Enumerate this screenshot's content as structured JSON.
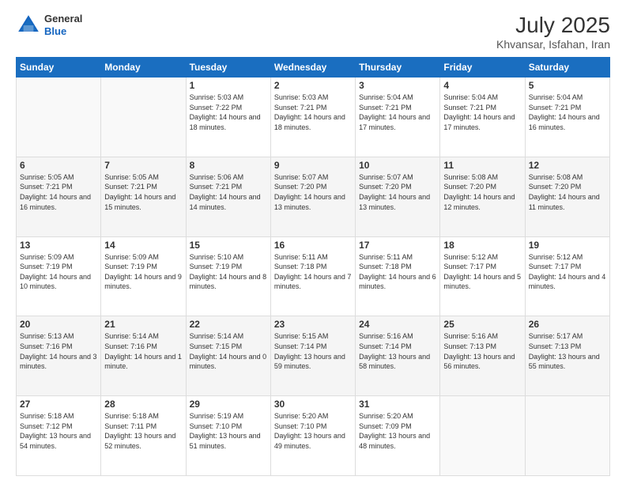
{
  "header": {
    "logo_general": "General",
    "logo_blue": "Blue",
    "title": "July 2025",
    "subtitle": "Khvansar, Isfahan, Iran"
  },
  "days_of_week": [
    "Sunday",
    "Monday",
    "Tuesday",
    "Wednesday",
    "Thursday",
    "Friday",
    "Saturday"
  ],
  "weeks": [
    [
      {
        "num": "",
        "info": ""
      },
      {
        "num": "",
        "info": ""
      },
      {
        "num": "1",
        "info": "Sunrise: 5:03 AM\nSunset: 7:22 PM\nDaylight: 14 hours and 18 minutes."
      },
      {
        "num": "2",
        "info": "Sunrise: 5:03 AM\nSunset: 7:21 PM\nDaylight: 14 hours and 18 minutes."
      },
      {
        "num": "3",
        "info": "Sunrise: 5:04 AM\nSunset: 7:21 PM\nDaylight: 14 hours and 17 minutes."
      },
      {
        "num": "4",
        "info": "Sunrise: 5:04 AM\nSunset: 7:21 PM\nDaylight: 14 hours and 17 minutes."
      },
      {
        "num": "5",
        "info": "Sunrise: 5:04 AM\nSunset: 7:21 PM\nDaylight: 14 hours and 16 minutes."
      }
    ],
    [
      {
        "num": "6",
        "info": "Sunrise: 5:05 AM\nSunset: 7:21 PM\nDaylight: 14 hours and 16 minutes."
      },
      {
        "num": "7",
        "info": "Sunrise: 5:05 AM\nSunset: 7:21 PM\nDaylight: 14 hours and 15 minutes."
      },
      {
        "num": "8",
        "info": "Sunrise: 5:06 AM\nSunset: 7:21 PM\nDaylight: 14 hours and 14 minutes."
      },
      {
        "num": "9",
        "info": "Sunrise: 5:07 AM\nSunset: 7:20 PM\nDaylight: 14 hours and 13 minutes."
      },
      {
        "num": "10",
        "info": "Sunrise: 5:07 AM\nSunset: 7:20 PM\nDaylight: 14 hours and 13 minutes."
      },
      {
        "num": "11",
        "info": "Sunrise: 5:08 AM\nSunset: 7:20 PM\nDaylight: 14 hours and 12 minutes."
      },
      {
        "num": "12",
        "info": "Sunrise: 5:08 AM\nSunset: 7:20 PM\nDaylight: 14 hours and 11 minutes."
      }
    ],
    [
      {
        "num": "13",
        "info": "Sunrise: 5:09 AM\nSunset: 7:19 PM\nDaylight: 14 hours and 10 minutes."
      },
      {
        "num": "14",
        "info": "Sunrise: 5:09 AM\nSunset: 7:19 PM\nDaylight: 14 hours and 9 minutes."
      },
      {
        "num": "15",
        "info": "Sunrise: 5:10 AM\nSunset: 7:19 PM\nDaylight: 14 hours and 8 minutes."
      },
      {
        "num": "16",
        "info": "Sunrise: 5:11 AM\nSunset: 7:18 PM\nDaylight: 14 hours and 7 minutes."
      },
      {
        "num": "17",
        "info": "Sunrise: 5:11 AM\nSunset: 7:18 PM\nDaylight: 14 hours and 6 minutes."
      },
      {
        "num": "18",
        "info": "Sunrise: 5:12 AM\nSunset: 7:17 PM\nDaylight: 14 hours and 5 minutes."
      },
      {
        "num": "19",
        "info": "Sunrise: 5:12 AM\nSunset: 7:17 PM\nDaylight: 14 hours and 4 minutes."
      }
    ],
    [
      {
        "num": "20",
        "info": "Sunrise: 5:13 AM\nSunset: 7:16 PM\nDaylight: 14 hours and 3 minutes."
      },
      {
        "num": "21",
        "info": "Sunrise: 5:14 AM\nSunset: 7:16 PM\nDaylight: 14 hours and 1 minute."
      },
      {
        "num": "22",
        "info": "Sunrise: 5:14 AM\nSunset: 7:15 PM\nDaylight: 14 hours and 0 minutes."
      },
      {
        "num": "23",
        "info": "Sunrise: 5:15 AM\nSunset: 7:14 PM\nDaylight: 13 hours and 59 minutes."
      },
      {
        "num": "24",
        "info": "Sunrise: 5:16 AM\nSunset: 7:14 PM\nDaylight: 13 hours and 58 minutes."
      },
      {
        "num": "25",
        "info": "Sunrise: 5:16 AM\nSunset: 7:13 PM\nDaylight: 13 hours and 56 minutes."
      },
      {
        "num": "26",
        "info": "Sunrise: 5:17 AM\nSunset: 7:13 PM\nDaylight: 13 hours and 55 minutes."
      }
    ],
    [
      {
        "num": "27",
        "info": "Sunrise: 5:18 AM\nSunset: 7:12 PM\nDaylight: 13 hours and 54 minutes."
      },
      {
        "num": "28",
        "info": "Sunrise: 5:18 AM\nSunset: 7:11 PM\nDaylight: 13 hours and 52 minutes."
      },
      {
        "num": "29",
        "info": "Sunrise: 5:19 AM\nSunset: 7:10 PM\nDaylight: 13 hours and 51 minutes."
      },
      {
        "num": "30",
        "info": "Sunrise: 5:20 AM\nSunset: 7:10 PM\nDaylight: 13 hours and 49 minutes."
      },
      {
        "num": "31",
        "info": "Sunrise: 5:20 AM\nSunset: 7:09 PM\nDaylight: 13 hours and 48 minutes."
      },
      {
        "num": "",
        "info": ""
      },
      {
        "num": "",
        "info": ""
      }
    ]
  ]
}
